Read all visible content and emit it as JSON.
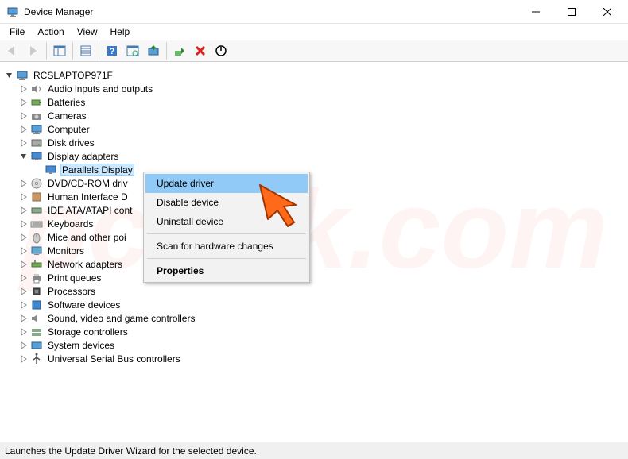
{
  "window": {
    "title": "Device Manager"
  },
  "menu": {
    "items": [
      "File",
      "Action",
      "View",
      "Help"
    ]
  },
  "tree": {
    "root": "RCSLAPTOP971F",
    "nodes": [
      {
        "label": "Audio inputs and outputs",
        "expanded": false,
        "indent": 1,
        "icon": "speaker"
      },
      {
        "label": "Batteries",
        "expanded": false,
        "indent": 1,
        "icon": "battery"
      },
      {
        "label": "Cameras",
        "expanded": false,
        "indent": 1,
        "icon": "camera"
      },
      {
        "label": "Computer",
        "expanded": false,
        "indent": 1,
        "icon": "computer"
      },
      {
        "label": "Disk drives",
        "expanded": false,
        "indent": 1,
        "icon": "disk"
      },
      {
        "label": "Display adapters",
        "expanded": true,
        "indent": 1,
        "icon": "display"
      },
      {
        "label": "Parallels Display",
        "expanded": null,
        "indent": 2,
        "icon": "display",
        "selected": true
      },
      {
        "label": "DVD/CD-ROM driv",
        "expanded": false,
        "indent": 1,
        "icon": "dvd"
      },
      {
        "label": "Human Interface D",
        "expanded": false,
        "indent": 1,
        "icon": "hid"
      },
      {
        "label": "IDE ATA/ATAPI cont",
        "expanded": false,
        "indent": 1,
        "icon": "ide"
      },
      {
        "label": "Keyboards",
        "expanded": false,
        "indent": 1,
        "icon": "keyboard"
      },
      {
        "label": "Mice and other poi",
        "expanded": false,
        "indent": 1,
        "icon": "mouse"
      },
      {
        "label": "Monitors",
        "expanded": false,
        "indent": 1,
        "icon": "monitor"
      },
      {
        "label": "Network adapters",
        "expanded": false,
        "indent": 1,
        "icon": "network"
      },
      {
        "label": "Print queues",
        "expanded": false,
        "indent": 1,
        "icon": "printer"
      },
      {
        "label": "Processors",
        "expanded": false,
        "indent": 1,
        "icon": "cpu"
      },
      {
        "label": "Software devices",
        "expanded": false,
        "indent": 1,
        "icon": "software"
      },
      {
        "label": "Sound, video and game controllers",
        "expanded": false,
        "indent": 1,
        "icon": "sound"
      },
      {
        "label": "Storage controllers",
        "expanded": false,
        "indent": 1,
        "icon": "storage"
      },
      {
        "label": "System devices",
        "expanded": false,
        "indent": 1,
        "icon": "system"
      },
      {
        "label": "Universal Serial Bus controllers",
        "expanded": false,
        "indent": 1,
        "icon": "usb"
      }
    ]
  },
  "context_menu": {
    "items": [
      {
        "label": "Update driver",
        "highlight": true
      },
      {
        "label": "Disable device"
      },
      {
        "label": "Uninstall device"
      },
      {
        "sep": true
      },
      {
        "label": "Scan for hardware changes"
      },
      {
        "sep": true
      },
      {
        "label": "Properties",
        "bold": true
      }
    ]
  },
  "status": "Launches the Update Driver Wizard for the selected device.",
  "watermark": "pcrisk.com"
}
